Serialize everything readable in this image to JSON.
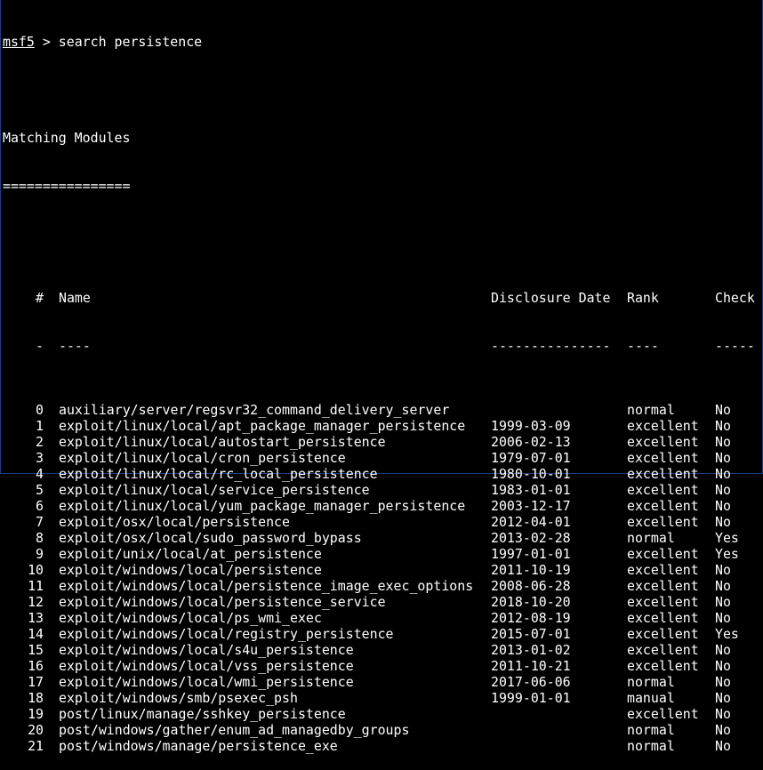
{
  "prompt": {
    "name": "msf5",
    "symbol": ">",
    "command": "search persistence"
  },
  "heading": {
    "title": "Matching Modules",
    "rule": "================"
  },
  "table": {
    "headers": {
      "index": "#",
      "name": "Name",
      "date": "Disclosure Date",
      "rank": "Rank",
      "check": "Check"
    },
    "dividers": {
      "index": "-",
      "name": "----",
      "date": "---------------",
      "rank": "----",
      "check": "-----"
    },
    "rows": [
      {
        "index": "0",
        "name": "auxiliary/server/regsvr32_command_delivery_server",
        "date": "",
        "rank": "normal",
        "check": "No"
      },
      {
        "index": "1",
        "name": "exploit/linux/local/apt_package_manager_persistence",
        "date": "1999-03-09",
        "rank": "excellent",
        "check": "No"
      },
      {
        "index": "2",
        "name": "exploit/linux/local/autostart_persistence",
        "date": "2006-02-13",
        "rank": "excellent",
        "check": "No"
      },
      {
        "index": "3",
        "name": "exploit/linux/local/cron_persistence",
        "date": "1979-07-01",
        "rank": "excellent",
        "check": "No"
      },
      {
        "index": "4",
        "name": "exploit/linux/local/rc_local_persistence",
        "date": "1980-10-01",
        "rank": "excellent",
        "check": "No"
      },
      {
        "index": "5",
        "name": "exploit/linux/local/service_persistence",
        "date": "1983-01-01",
        "rank": "excellent",
        "check": "No"
      },
      {
        "index": "6",
        "name": "exploit/linux/local/yum_package_manager_persistence",
        "date": "2003-12-17",
        "rank": "excellent",
        "check": "No"
      },
      {
        "index": "7",
        "name": "exploit/osx/local/persistence",
        "date": "2012-04-01",
        "rank": "excellent",
        "check": "No"
      },
      {
        "index": "8",
        "name": "exploit/osx/local/sudo_password_bypass",
        "date": "2013-02-28",
        "rank": "normal",
        "check": "Yes"
      },
      {
        "index": "9",
        "name": "exploit/unix/local/at_persistence",
        "date": "1997-01-01",
        "rank": "excellent",
        "check": "Yes"
      },
      {
        "index": "10",
        "name": "exploit/windows/local/persistence",
        "date": "2011-10-19",
        "rank": "excellent",
        "check": "No"
      },
      {
        "index": "11",
        "name": "exploit/windows/local/persistence_image_exec_options",
        "date": "2008-06-28",
        "rank": "excellent",
        "check": "No"
      },
      {
        "index": "12",
        "name": "exploit/windows/local/persistence_service",
        "date": "2018-10-20",
        "rank": "excellent",
        "check": "No"
      },
      {
        "index": "13",
        "name": "exploit/windows/local/ps_wmi_exec",
        "date": "2012-08-19",
        "rank": "excellent",
        "check": "No"
      },
      {
        "index": "14",
        "name": "exploit/windows/local/registry_persistence",
        "date": "2015-07-01",
        "rank": "excellent",
        "check": "Yes"
      },
      {
        "index": "15",
        "name": "exploit/windows/local/s4u_persistence",
        "date": "2013-01-02",
        "rank": "excellent",
        "check": "No"
      },
      {
        "index": "16",
        "name": "exploit/windows/local/vss_persistence",
        "date": "2011-10-21",
        "rank": "excellent",
        "check": "No"
      },
      {
        "index": "17",
        "name": "exploit/windows/local/wmi_persistence",
        "date": "2017-06-06",
        "rank": "normal",
        "check": "No"
      },
      {
        "index": "18",
        "name": "exploit/windows/smb/psexec_psh",
        "date": "1999-01-01",
        "rank": "manual",
        "check": "No"
      },
      {
        "index": "19",
        "name": "post/linux/manage/sshkey_persistence",
        "date": "",
        "rank": "excellent",
        "check": "No"
      },
      {
        "index": "20",
        "name": "post/windows/gather/enum_ad_managedby_groups",
        "date": "",
        "rank": "normal",
        "check": "No"
      },
      {
        "index": "21",
        "name": "post/windows/manage/persistence_exe",
        "date": "",
        "rank": "normal",
        "check": "No"
      }
    ]
  }
}
